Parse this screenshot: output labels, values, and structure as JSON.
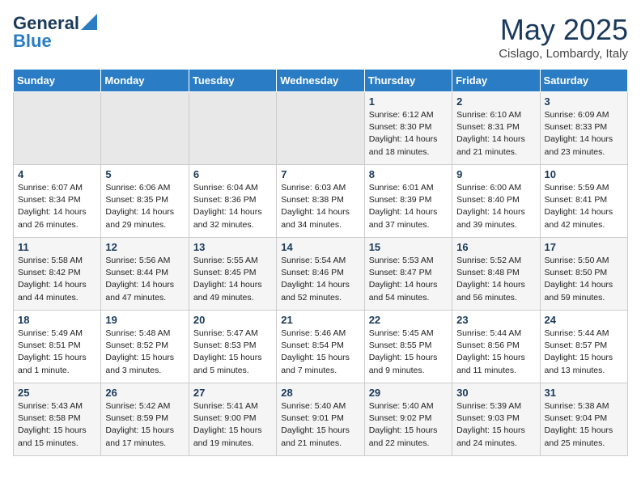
{
  "header": {
    "logo_general": "General",
    "logo_blue": "Blue",
    "title": "May 2025",
    "location": "Cislago, Lombardy, Italy"
  },
  "weekdays": [
    "Sunday",
    "Monday",
    "Tuesday",
    "Wednesday",
    "Thursday",
    "Friday",
    "Saturday"
  ],
  "weeks": [
    [
      {
        "day": "",
        "info": ""
      },
      {
        "day": "",
        "info": ""
      },
      {
        "day": "",
        "info": ""
      },
      {
        "day": "",
        "info": ""
      },
      {
        "day": "1",
        "info": "Sunrise: 6:12 AM\nSunset: 8:30 PM\nDaylight: 14 hours\nand 18 minutes."
      },
      {
        "day": "2",
        "info": "Sunrise: 6:10 AM\nSunset: 8:31 PM\nDaylight: 14 hours\nand 21 minutes."
      },
      {
        "day": "3",
        "info": "Sunrise: 6:09 AM\nSunset: 8:33 PM\nDaylight: 14 hours\nand 23 minutes."
      }
    ],
    [
      {
        "day": "4",
        "info": "Sunrise: 6:07 AM\nSunset: 8:34 PM\nDaylight: 14 hours\nand 26 minutes."
      },
      {
        "day": "5",
        "info": "Sunrise: 6:06 AM\nSunset: 8:35 PM\nDaylight: 14 hours\nand 29 minutes."
      },
      {
        "day": "6",
        "info": "Sunrise: 6:04 AM\nSunset: 8:36 PM\nDaylight: 14 hours\nand 32 minutes."
      },
      {
        "day": "7",
        "info": "Sunrise: 6:03 AM\nSunset: 8:38 PM\nDaylight: 14 hours\nand 34 minutes."
      },
      {
        "day": "8",
        "info": "Sunrise: 6:01 AM\nSunset: 8:39 PM\nDaylight: 14 hours\nand 37 minutes."
      },
      {
        "day": "9",
        "info": "Sunrise: 6:00 AM\nSunset: 8:40 PM\nDaylight: 14 hours\nand 39 minutes."
      },
      {
        "day": "10",
        "info": "Sunrise: 5:59 AM\nSunset: 8:41 PM\nDaylight: 14 hours\nand 42 minutes."
      }
    ],
    [
      {
        "day": "11",
        "info": "Sunrise: 5:58 AM\nSunset: 8:42 PM\nDaylight: 14 hours\nand 44 minutes."
      },
      {
        "day": "12",
        "info": "Sunrise: 5:56 AM\nSunset: 8:44 PM\nDaylight: 14 hours\nand 47 minutes."
      },
      {
        "day": "13",
        "info": "Sunrise: 5:55 AM\nSunset: 8:45 PM\nDaylight: 14 hours\nand 49 minutes."
      },
      {
        "day": "14",
        "info": "Sunrise: 5:54 AM\nSunset: 8:46 PM\nDaylight: 14 hours\nand 52 minutes."
      },
      {
        "day": "15",
        "info": "Sunrise: 5:53 AM\nSunset: 8:47 PM\nDaylight: 14 hours\nand 54 minutes."
      },
      {
        "day": "16",
        "info": "Sunrise: 5:52 AM\nSunset: 8:48 PM\nDaylight: 14 hours\nand 56 minutes."
      },
      {
        "day": "17",
        "info": "Sunrise: 5:50 AM\nSunset: 8:50 PM\nDaylight: 14 hours\nand 59 minutes."
      }
    ],
    [
      {
        "day": "18",
        "info": "Sunrise: 5:49 AM\nSunset: 8:51 PM\nDaylight: 15 hours\nand 1 minute."
      },
      {
        "day": "19",
        "info": "Sunrise: 5:48 AM\nSunset: 8:52 PM\nDaylight: 15 hours\nand 3 minutes."
      },
      {
        "day": "20",
        "info": "Sunrise: 5:47 AM\nSunset: 8:53 PM\nDaylight: 15 hours\nand 5 minutes."
      },
      {
        "day": "21",
        "info": "Sunrise: 5:46 AM\nSunset: 8:54 PM\nDaylight: 15 hours\nand 7 minutes."
      },
      {
        "day": "22",
        "info": "Sunrise: 5:45 AM\nSunset: 8:55 PM\nDaylight: 15 hours\nand 9 minutes."
      },
      {
        "day": "23",
        "info": "Sunrise: 5:44 AM\nSunset: 8:56 PM\nDaylight: 15 hours\nand 11 minutes."
      },
      {
        "day": "24",
        "info": "Sunrise: 5:44 AM\nSunset: 8:57 PM\nDaylight: 15 hours\nand 13 minutes."
      }
    ],
    [
      {
        "day": "25",
        "info": "Sunrise: 5:43 AM\nSunset: 8:58 PM\nDaylight: 15 hours\nand 15 minutes."
      },
      {
        "day": "26",
        "info": "Sunrise: 5:42 AM\nSunset: 8:59 PM\nDaylight: 15 hours\nand 17 minutes."
      },
      {
        "day": "27",
        "info": "Sunrise: 5:41 AM\nSunset: 9:00 PM\nDaylight: 15 hours\nand 19 minutes."
      },
      {
        "day": "28",
        "info": "Sunrise: 5:40 AM\nSunset: 9:01 PM\nDaylight: 15 hours\nand 21 minutes."
      },
      {
        "day": "29",
        "info": "Sunrise: 5:40 AM\nSunset: 9:02 PM\nDaylight: 15 hours\nand 22 minutes."
      },
      {
        "day": "30",
        "info": "Sunrise: 5:39 AM\nSunset: 9:03 PM\nDaylight: 15 hours\nand 24 minutes."
      },
      {
        "day": "31",
        "info": "Sunrise: 5:38 AM\nSunset: 9:04 PM\nDaylight: 15 hours\nand 25 minutes."
      }
    ]
  ]
}
